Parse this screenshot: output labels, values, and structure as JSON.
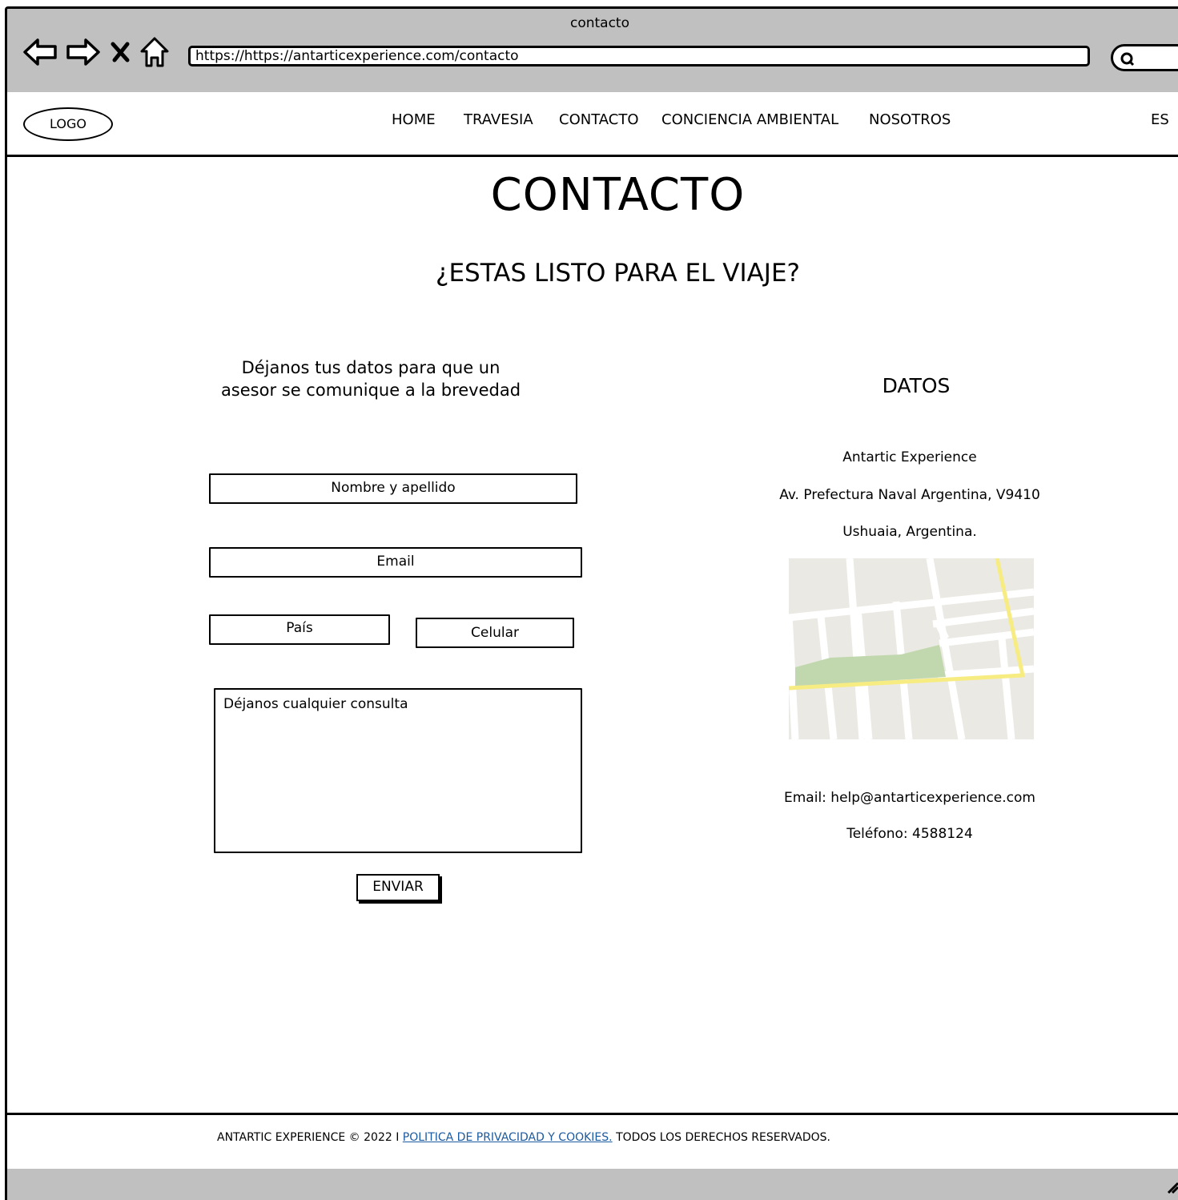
{
  "browser": {
    "window_title": "contacto",
    "url": "https://https://antarticexperience.com/contacto",
    "icons": [
      "back-icon",
      "forward-icon",
      "close-icon",
      "home-icon",
      "search-icon",
      "resize-icon"
    ]
  },
  "header": {
    "logo": "LOGO",
    "menu": [
      "HOME",
      "TRAVESIA",
      "CONTACTO",
      "CONCIENCIA AMBIENTAL",
      "NOSOTROS"
    ],
    "language": "ES"
  },
  "main": {
    "title": "CONTACTO",
    "subtitle": "¿ESTAS LISTO PARA EL VIAJE?"
  },
  "form": {
    "intro_line1": "Déjanos tus datos para que un",
    "intro_line2": "asesor se comunique a la brevedad",
    "name_placeholder": "Nombre y apellido",
    "email_placeholder": "Email",
    "country_placeholder": "País",
    "phone_placeholder": "Celular",
    "message_placeholder": "Déjanos cualquier consulta",
    "submit_label": "ENVIAR"
  },
  "datos": {
    "title": "DATOS",
    "company": "Antartic Experience",
    "address_line1": "Av. Prefectura Naval Argentina, V9410",
    "address_line2": "Ushuaia, Argentina.",
    "email": "Email: help@antarticexperience.com",
    "phone": "Teléfono: 4588124"
  },
  "footer": {
    "prefix": "ANTARTIC EXPERIENCE © 2022 I ",
    "link": "POLITICA DE PRIVACIDAD Y COOKIES.",
    "suffix": " TODOS LOS DERECHOS RESERVADOS."
  },
  "colors": {
    "chrome": "#c0c0c0",
    "map_ground": "#ebe9e3",
    "map_park": "#c1d8ae",
    "map_main_road": "#f7ec82",
    "link": "#1a5aa0"
  }
}
